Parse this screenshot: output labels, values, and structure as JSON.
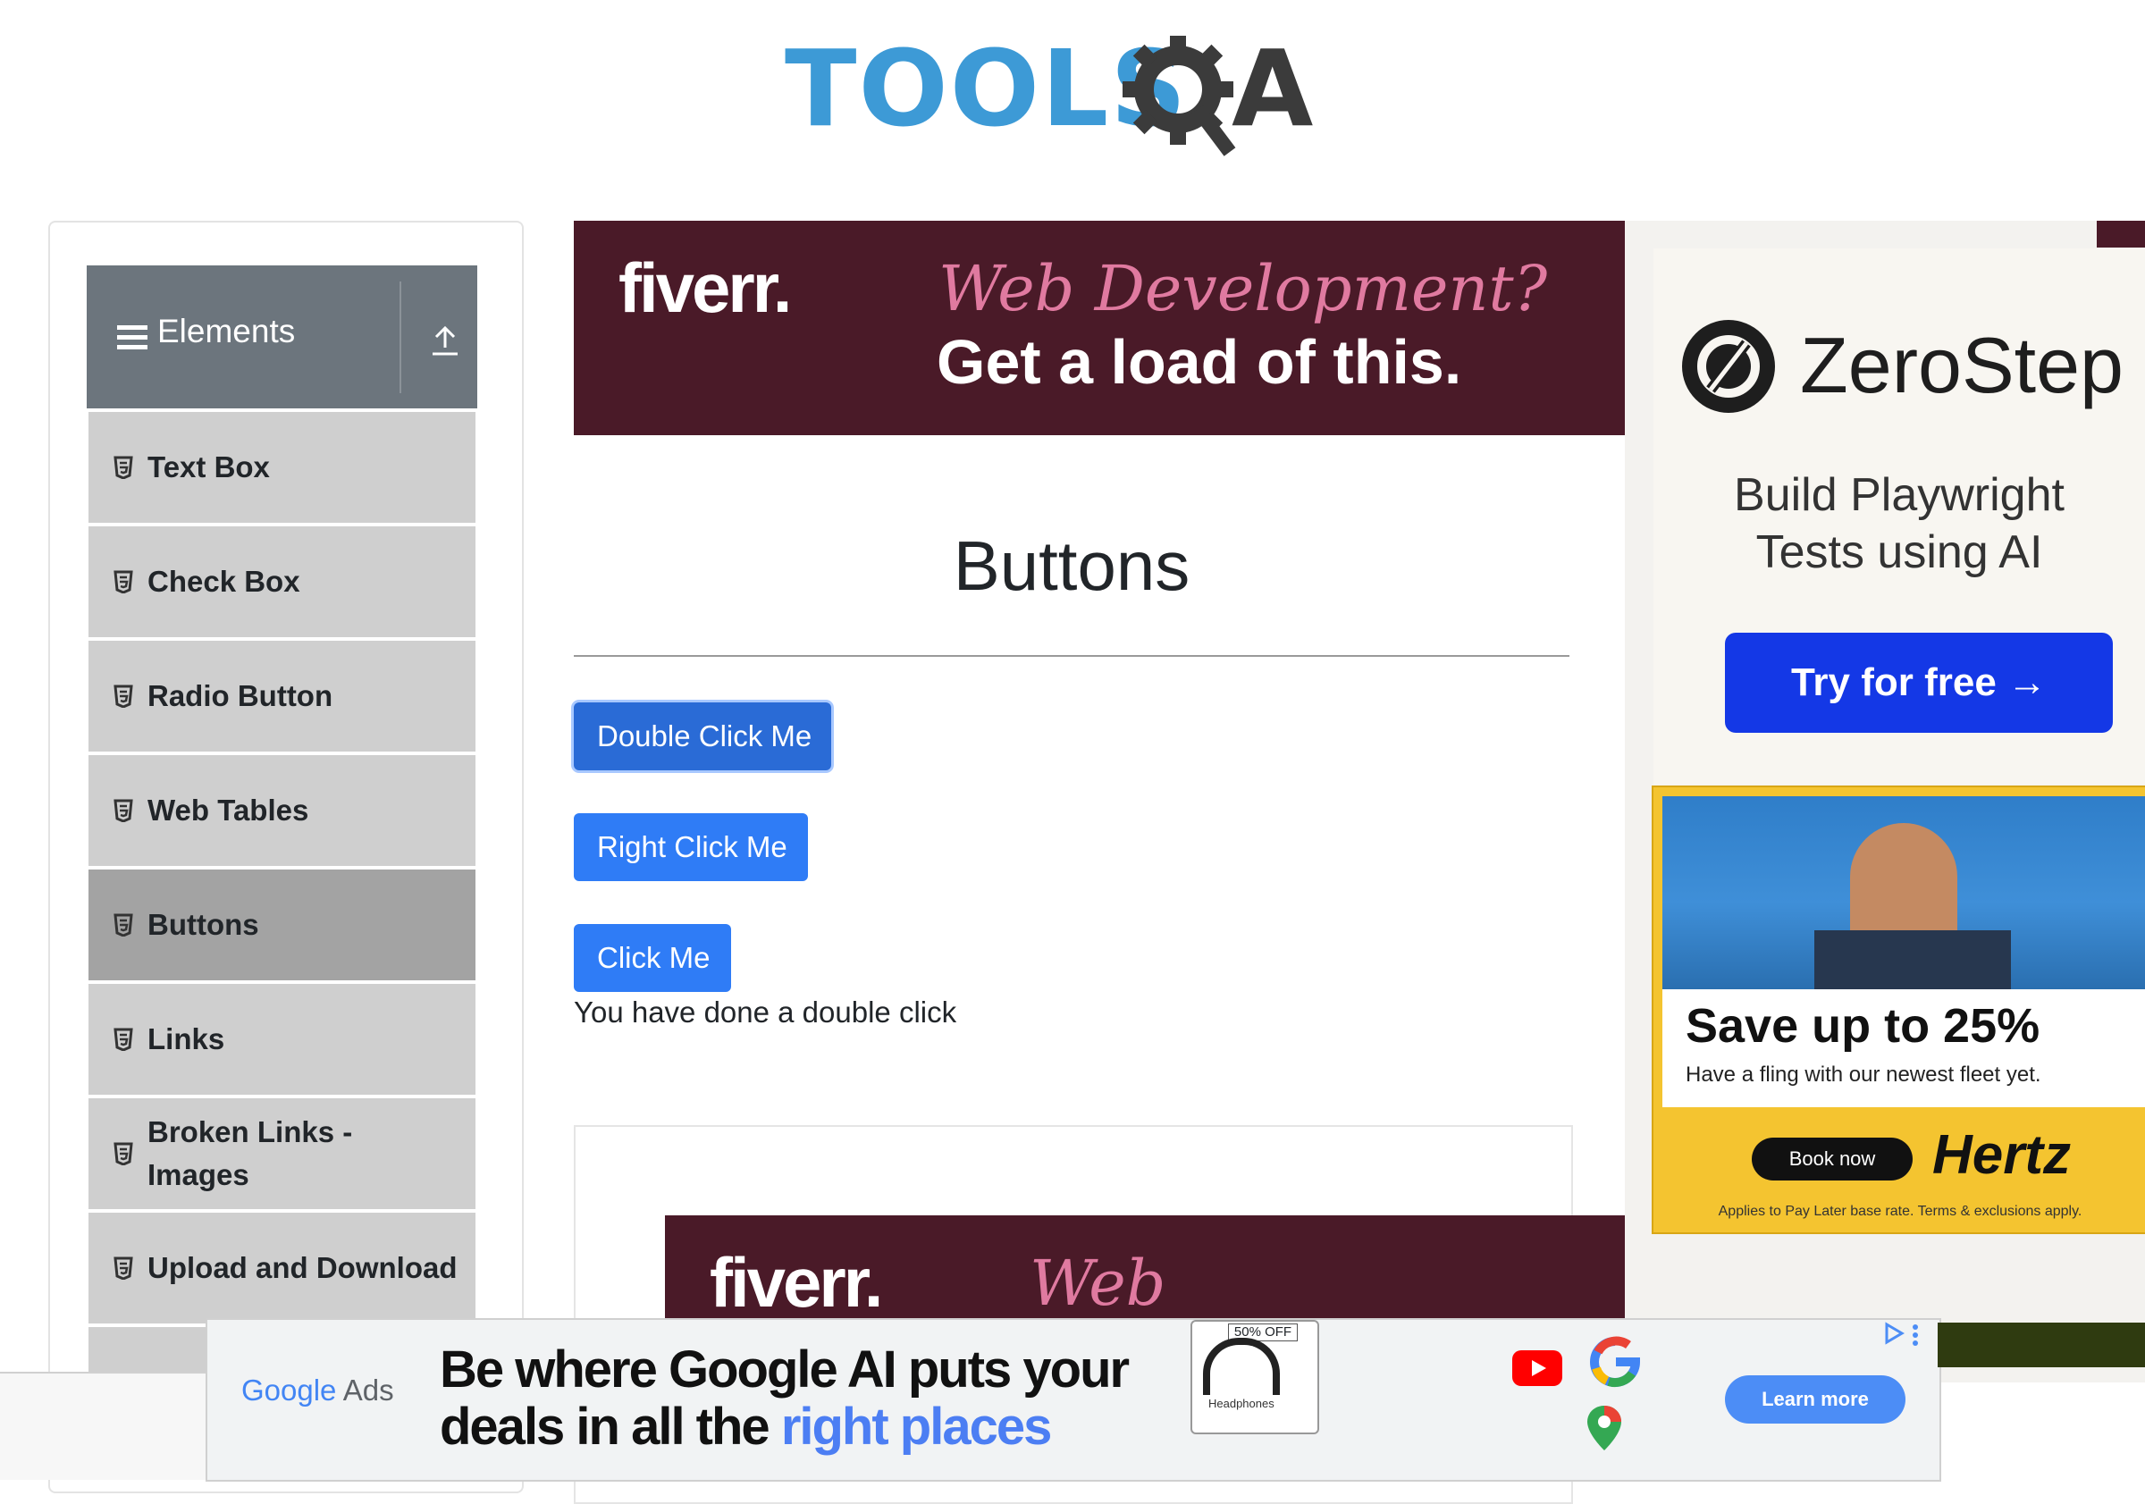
{
  "logo": {
    "part1": "TOOLS",
    "part2": "A"
  },
  "sidebar": {
    "group_title": "Elements",
    "items": [
      {
        "label": "Text Box"
      },
      {
        "label": "Check Box"
      },
      {
        "label": "Radio Button"
      },
      {
        "label": "Web Tables"
      },
      {
        "label": "Buttons"
      },
      {
        "label": "Links"
      },
      {
        "label": "Broken Links -",
        "label2": "Images"
      },
      {
        "label": "Upload and Download"
      }
    ],
    "active_item": "Buttons"
  },
  "main": {
    "title": "Buttons",
    "buttons": {
      "double": "Double Click Me",
      "right": "Right Click Me",
      "click": "Click Me"
    },
    "message": "You have done a double click"
  },
  "ads": {
    "fiverr_top": {
      "brand": "fiverr.",
      "line1": "Web Development?",
      "line2": "Get a load of this."
    },
    "fiverr_bottom": {
      "brand": "fiverr.",
      "line1": "Web Development?"
    },
    "zerostep": {
      "brand": "ZeroStep",
      "line1": "Build Playwright",
      "line2": "Tests using AI",
      "cta": "Try for free →"
    },
    "hertz": {
      "headline": "Save up to 25%",
      "sub": "Have a fling with our newest fleet yet.",
      "cta": "Book now",
      "brand": "Hertz",
      "fine": "Applies to Pay Later base rate. Terms & exclusions apply."
    },
    "google": {
      "brand1": "Google",
      "brand2": " Ads",
      "line1": "Be where Google AI puts your",
      "line2a": "deals in all the ",
      "line2b": "right places",
      "badge": "50% OFF",
      "product": "Headphones",
      "cta": "Learn more"
    }
  },
  "colors": {
    "brand_blue": "#3d9ad6",
    "button_blue": "#2f7cf6",
    "sidebar_header": "#6c757d",
    "fiverr_bg": "#4a1a28",
    "zerostep_cta": "#1438e6",
    "hertz_yellow": "#f4c430"
  }
}
